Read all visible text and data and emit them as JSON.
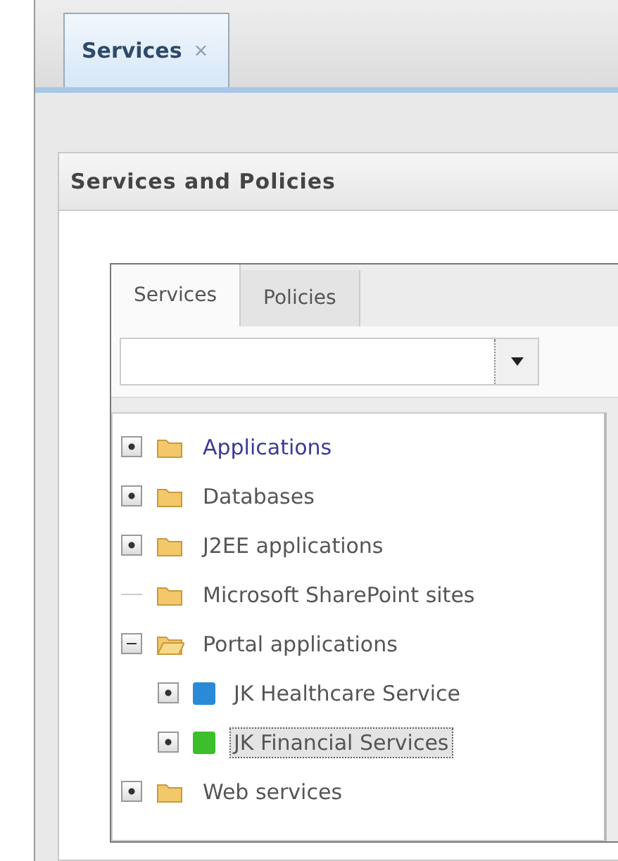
{
  "tabs": [
    {
      "label": "Services",
      "close": "×",
      "selected": true
    }
  ],
  "panel": {
    "title": "Services and Policies"
  },
  "inner_tabs": [
    {
      "label": "Services",
      "selected": true
    },
    {
      "label": "Policies",
      "selected": false
    }
  ],
  "tree": [
    {
      "label": "Applications",
      "kind": "folder",
      "expanded": false,
      "selected": false,
      "link": true
    },
    {
      "label": "Databases",
      "kind": "folder",
      "expanded": false,
      "selected": false
    },
    {
      "label": "J2EE applications",
      "kind": "folder",
      "expanded": false,
      "selected": false
    },
    {
      "label": "Microsoft SharePoint sites",
      "kind": "folder",
      "selected": false
    },
    {
      "label": "Portal applications",
      "kind": "folder",
      "expanded": true,
      "selected": false,
      "children": [
        {
          "label": "JK Healthcare Service",
          "kind": "service",
          "color": "#2a8ad8",
          "expanded": false,
          "selected": false
        },
        {
          "label": "JK Financial Services",
          "kind": "service",
          "color": "#3cbf2a",
          "expanded": false,
          "selected": true
        }
      ]
    },
    {
      "label": "Web services",
      "kind": "folder",
      "expanded": false,
      "selected": false
    }
  ]
}
